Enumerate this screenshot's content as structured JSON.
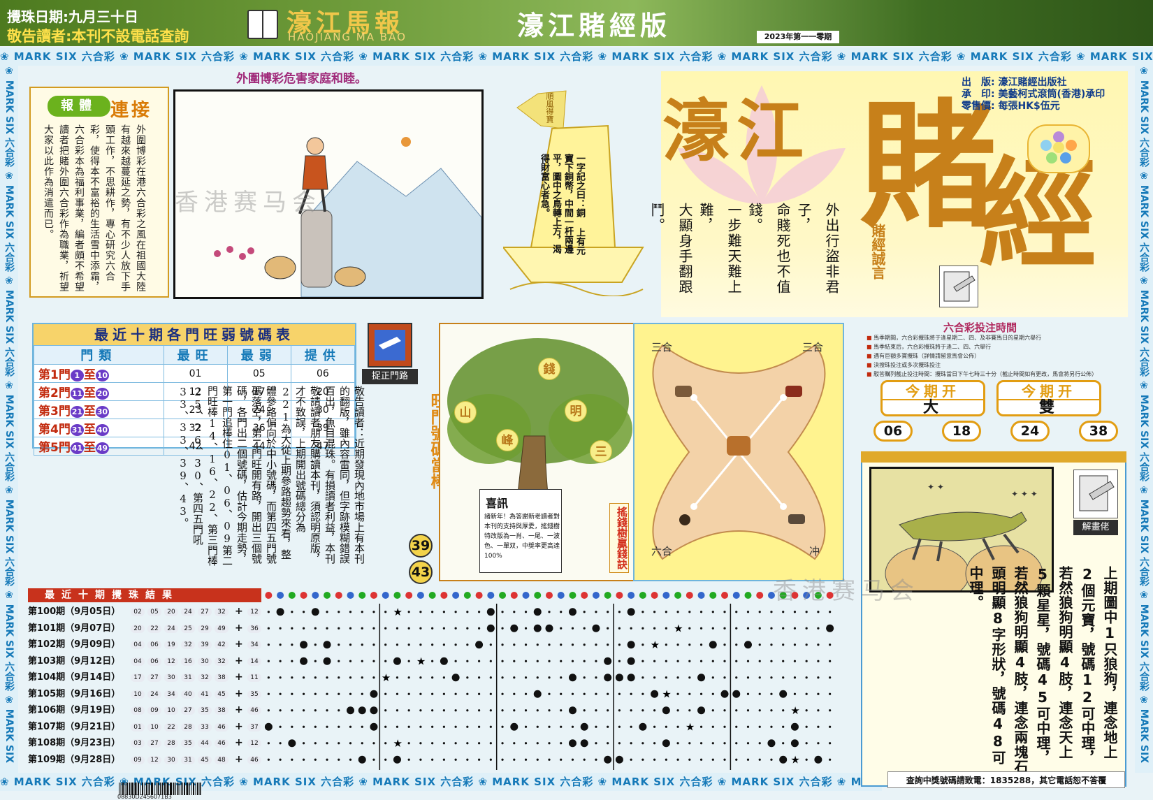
{
  "header": {
    "date_line": "攪珠日期:九月三十日",
    "notice_line": "敬告讀者:本刊不設電話查詢",
    "paper_name": "濠江馬報",
    "paper_name_en": "HAOJIANG MA BAO",
    "edition": "濠江賭經版",
    "issue": "2023年第一一零期"
  },
  "border": {
    "strip_text": "❀ MARK SIX 六合彩 ❀ MARK SIX 六合彩 ❀ MARK SIX 六合彩 ❀ MARK SIX 六合彩 ❀ MARK SIX 六合彩 ❀ MARK SIX 六合彩 ❀ MARK SIX 六合彩 ❀ MARK SIX 六合彩 ❀ MARK SIX 六合彩 ❀ MARK SIX 六合彩",
    "color": "#1579b8"
  },
  "slogan": "外圍博彩危害家庭和睦。",
  "essay": {
    "tag1": "報體",
    "tag2": "連接",
    "text": "外圍博彩在港六合彩之風在祖國大陸有越來越蔓延之勢，有不少人放下手頭工作，不思耕作，專心研究六合彩，使得本不富裕的生活雪中添霜，六合彩本為福利事業，編者頗不希望讀者把賭外圍六合彩作為職業，祈望大家以此作為消遣而已。"
  },
  "boat": {
    "flag": "順風得寶",
    "verse": "一字記之曰：銅 上有元寶下銅幣，中間一杆兩邊平，圖中之鳥轉上方，渴得財富心者急。"
  },
  "hero": {
    "title1": "濠江",
    "title2": "賭",
    "title3": "經",
    "proverb_tag": "賭經誠言",
    "proverbs": [
      "外出行盜非君子，",
      "命賤死也不值錢。",
      "一步難天難上難，",
      "大顯身手翻跟鬥。"
    ],
    "publisher": [
      {
        "label": "出　版:",
        "value": "濠江賭經出版社"
      },
      {
        "label": "承　印:",
        "value": "美藝柯式滾筒(香港)承印"
      },
      {
        "label": "零售價:",
        "value": "每張HK$伍元"
      }
    ]
  },
  "stats": {
    "title": "最近十期各門旺弱號碼表",
    "headers": [
      "門類",
      "最旺",
      "最弱",
      "提供"
    ],
    "rows": [
      {
        "door": "第1門",
        "from": "1",
        "to": "10",
        "hot": "01",
        "cold": "05",
        "pick": "06"
      },
      {
        "door": "第2門",
        "from": "11",
        "to": "20",
        "hot": "12",
        "cold": "17",
        "pick": "20"
      },
      {
        "door": "第3門",
        "from": "21",
        "to": "30",
        "hot": "23",
        "cold": "24",
        "pick": "30"
      },
      {
        "door": "第4門",
        "from": "31",
        "to": "40",
        "hot": "32",
        "cold": "36",
        "pick": "39"
      },
      {
        "door": "第5門",
        "from": "41",
        "to": "49",
        "hot": "42",
        "cold": "44",
        "pick": "47"
      }
    ],
    "connector": "至"
  },
  "zhuo": {
    "label": "捉正門路",
    "notice": "敬告讀者：近期發現內地市場上有本刊的翻版，雖內容雷同，但字跡模糊錯誤百出，魚目混珠。有損讀者利益，本刊敬請讀者朋友購讀本刊，須認明原版，才不致誤，上期開出號碼總分為221為大從上期參路趨勢來看，整體參路偏向於中小號碼，而第四五門號碼落空，第二門旺開有路，開出三個號碼，各門出二個號碼，估計今期走勢，第一門追棒住01、06、09第二門旺棒14、16、22、第三門棒25、26、30、第四五門吼33、33、39、43。"
  },
  "hot": {
    "title": "旺門號碼當棒",
    "numbers": [
      "39",
      "43"
    ]
  },
  "tree": {
    "words": [
      "山",
      "錢",
      "峰",
      "明",
      "三"
    ],
    "news_title": "喜訊",
    "news_text": "諸新年！為答謝新老讀者對本刊的支持與厚愛，搖錢樹特改版為一肖、一尾、一波色、一單双，中獎率更高達100%",
    "label": "搖錢樹贏錢訣"
  },
  "zodiac": {
    "labels": [
      "三合",
      "三合",
      "六合",
      "冲"
    ]
  },
  "times": {
    "title": "六合彩投注時間",
    "items": [
      "馬季期間，六合彩攪珠將于逢星期二、四、及非賽馬日的星期六舉行",
      "馬季結束后，六合彩攪珠將于逢二、四、六舉行",
      "遇有巨額多寶攪珠（詳情請留意馬會公佈）",
      "決搜珠投注或多次攪珠投注",
      "駁答購列截止投注時間：攪珠當日下午七時三十分（截止時間如有更改，馬會將另行公佈）"
    ]
  },
  "open": {
    "label": "今期开",
    "values": [
      "大",
      "雙"
    ],
    "numbers": [
      "06",
      "18",
      "24",
      "38"
    ]
  },
  "explain": {
    "label": "解畫佬",
    "text": "上期圖中1只狼狗，連念地上2個元寶，號碼12可中理，若然狼狗明顯4肢，連念天上5顆星星，號碼45可中理，若然狼狗明顯4肢，連念兩塊石頭明顯8字形狀，號碼48可中理。"
  },
  "results": {
    "title": "最近十期攪珠結果",
    "rows": [
      {
        "period": "第100期（9月05日）",
        "nums": [
          "02",
          "05",
          "20",
          "24",
          "27",
          "32"
        ],
        "special": "12"
      },
      {
        "period": "第101期（9月07日）",
        "nums": [
          "20",
          "22",
          "24",
          "25",
          "29",
          "49"
        ],
        "special": "36"
      },
      {
        "period": "第102期（9月09日）",
        "nums": [
          "04",
          "06",
          "19",
          "32",
          "39",
          "42"
        ],
        "special": "34"
      },
      {
        "period": "第103期（9月12日）",
        "nums": [
          "04",
          "06",
          "12",
          "16",
          "30",
          "32"
        ],
        "special": "14"
      },
      {
        "period": "第104期（9月14日）",
        "nums": [
          "17",
          "27",
          "30",
          "31",
          "32",
          "38"
        ],
        "special": "11"
      },
      {
        "period": "第105期（9月16日）",
        "nums": [
          "10",
          "24",
          "34",
          "40",
          "41",
          "45"
        ],
        "special": "35"
      },
      {
        "period": "第106期（9月19日）",
        "nums": [
          "08",
          "09",
          "10",
          "27",
          "35",
          "38"
        ],
        "special": "46"
      },
      {
        "period": "第107期（9月21日）",
        "nums": [
          "01",
          "10",
          "22",
          "28",
          "33",
          "46"
        ],
        "special": "37"
      },
      {
        "period": "第108期（9月23日）",
        "nums": [
          "03",
          "27",
          "28",
          "35",
          "44",
          "46"
        ],
        "special": "12"
      },
      {
        "period": "第109期（9月28日）",
        "nums": [
          "09",
          "12",
          "30",
          "31",
          "45",
          "48"
        ],
        "special": "46"
      }
    ],
    "plus": "+"
  },
  "footer": {
    "barcode": "08830D2456071B3",
    "notice": "查詢中獎號碼請致電：1835288，其它電話恕不答覆"
  },
  "watermarks": [
    "香港赛马会",
    "香港赛马会"
  ]
}
